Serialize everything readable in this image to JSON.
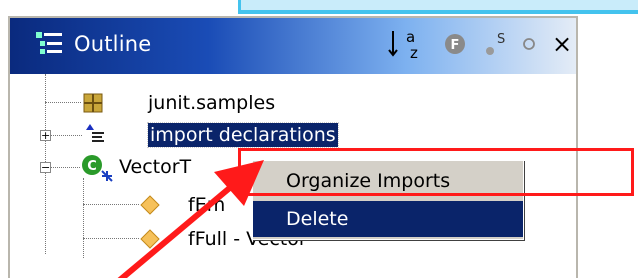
{
  "outline": {
    "title": "Outline",
    "toolbar": [
      {
        "name": "sort-alpha-icon",
        "glyph": "a-z"
      },
      {
        "name": "hide-fields-icon",
        "glyph": "F"
      },
      {
        "name": "hide-static-icon",
        "glyph": "S"
      },
      {
        "name": "hide-nonpublic-icon",
        "glyph": "o"
      },
      {
        "name": "close-icon",
        "glyph": "×"
      }
    ],
    "sort_sup": "a",
    "sort_sub": "z",
    "fields_glyph": "F",
    "static_glyph": "S",
    "close_glyph": "×"
  },
  "tree": {
    "items": [
      {
        "label": "junit.samples",
        "icon": "package-icon"
      },
      {
        "label": "import declarations",
        "icon": "imports-icon",
        "selected": true,
        "expander": "+"
      },
      {
        "label": "VectorTest",
        "icon": "class-icon",
        "expander": "−"
      },
      {
        "label": "fEmpty - Vector",
        "icon": "field-icon"
      },
      {
        "label": "fFull - Vector",
        "icon": "field-icon"
      }
    ],
    "vector_visible": "VectorT",
    "fempty_visible": "fEm",
    "class_badge": "C"
  },
  "context_menu": {
    "items": [
      {
        "label": "Organize Imports",
        "highlighted": false
      },
      {
        "label": "Delete",
        "highlighted": true
      }
    ]
  },
  "colors": {
    "selection": "#0a246a",
    "callout": "#ff1a1a",
    "accent": "#44c3ee"
  }
}
